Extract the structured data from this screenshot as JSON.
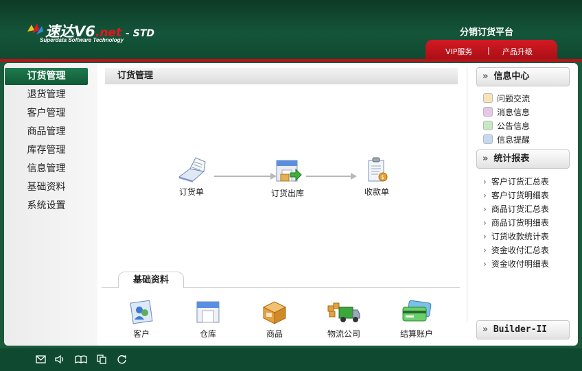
{
  "header": {
    "brand_name": "速达",
    "brand_version": "V6",
    "brand_net": ".net",
    "brand_edition": "- STD",
    "brand_sub": "Superdata Software Technology",
    "platform_title": "分销订货平台",
    "tabs": [
      "VIP服务",
      "|",
      "产品升级"
    ]
  },
  "leftnav": {
    "items": [
      {
        "label": "订货管理",
        "active": true
      },
      {
        "label": "退货管理",
        "active": false
      },
      {
        "label": "客户管理",
        "active": false
      },
      {
        "label": "商品管理",
        "active": false
      },
      {
        "label": "库存管理",
        "active": false
      },
      {
        "label": "信息管理",
        "active": false
      },
      {
        "label": "基础资料",
        "active": false
      },
      {
        "label": "系统设置",
        "active": false
      }
    ]
  },
  "center": {
    "title": "订货管理",
    "flow": [
      {
        "label": "订货单",
        "icon": "order-book-icon"
      },
      {
        "label": "订货出库",
        "icon": "warehouse-out-icon"
      },
      {
        "label": "收款单",
        "icon": "receipt-icon"
      }
    ],
    "basic_tab": "基础资料",
    "basic_items": [
      {
        "label": "客户",
        "icon": "customer-icon"
      },
      {
        "label": "仓库",
        "icon": "warehouse-icon"
      },
      {
        "label": "商品",
        "icon": "product-box-icon"
      },
      {
        "label": "物流公司",
        "icon": "truck-icon"
      },
      {
        "label": "结算账户",
        "icon": "card-icon"
      }
    ]
  },
  "right": {
    "info_title": "信息中心",
    "info_items": [
      {
        "label": "问题交流",
        "icon": "chat-icon",
        "color": "#e8a040"
      },
      {
        "label": "消息信息",
        "icon": "message-icon",
        "color": "#a03aa0"
      },
      {
        "label": "公告信息",
        "icon": "notice-icon",
        "color": "#3a9a4a"
      },
      {
        "label": "信息提醒",
        "icon": "reminder-icon",
        "color": "#3a7ad0"
      }
    ],
    "stats_title": "统计报表",
    "stats_items": [
      "客户订货汇总表",
      "客户订货明细表",
      "商品订货汇总表",
      "商品订货明细表",
      "订货收款统计表",
      "资金收付汇总表",
      "资金收付明细表"
    ],
    "builder_label": "Builder-II"
  },
  "footer": {
    "icons": [
      "mail-icon",
      "speaker-icon",
      "book-icon",
      "copy-icon",
      "refresh-icon"
    ]
  },
  "colors": {
    "header_green": "#14553a",
    "accent_red": "#d41a23",
    "nav_active": "#1f7a4f"
  }
}
